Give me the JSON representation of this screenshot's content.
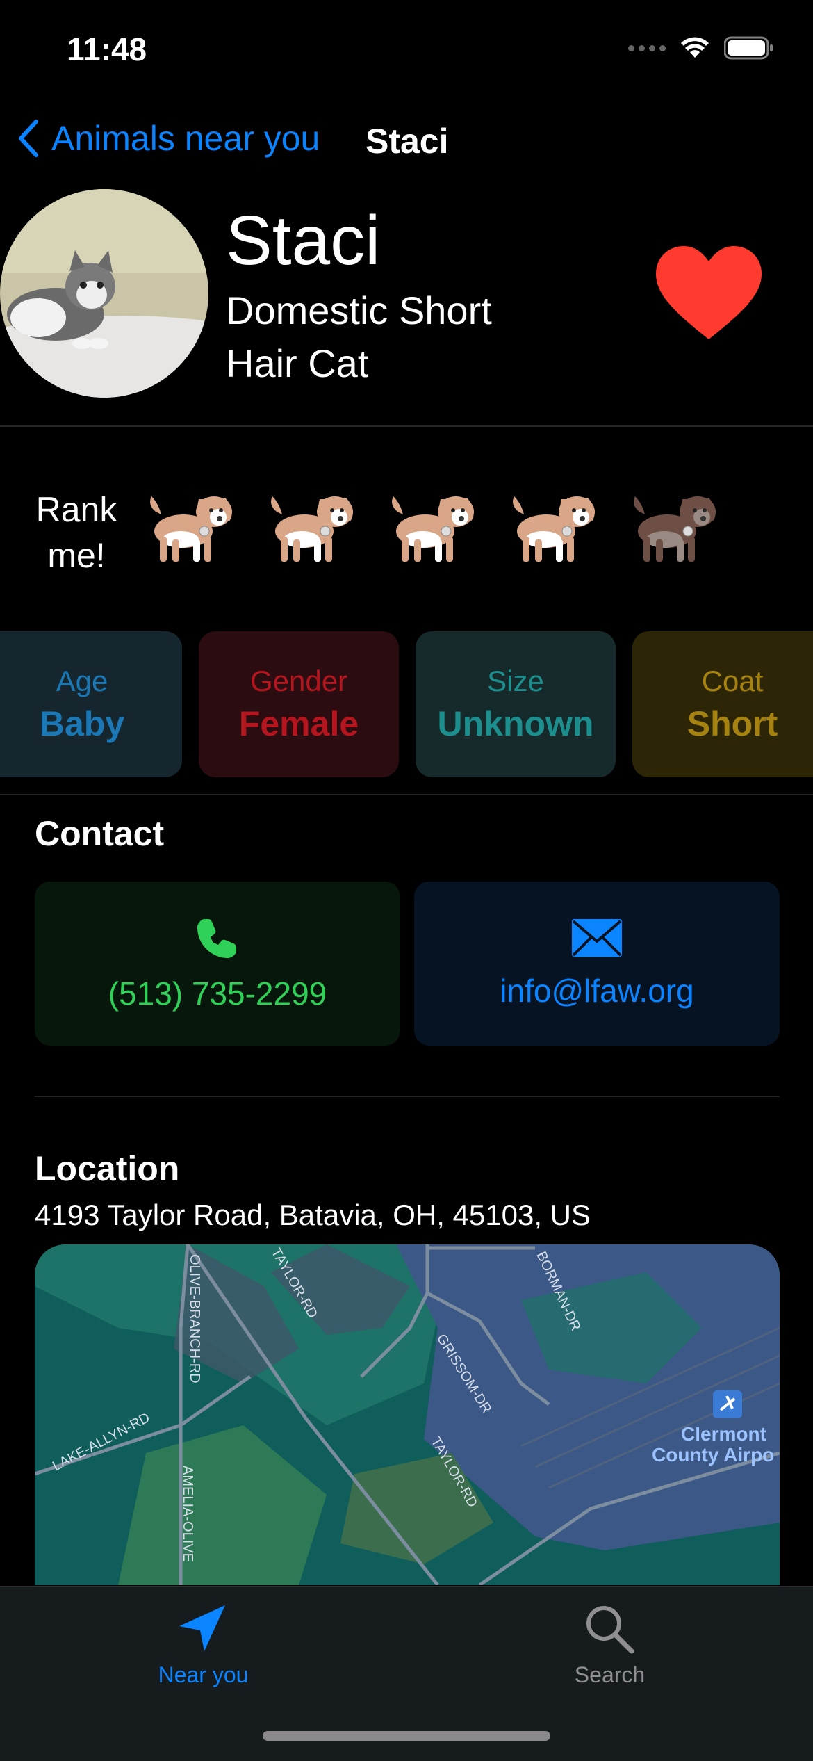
{
  "status_bar": {
    "time": "11:48"
  },
  "nav": {
    "back_label": "Animals near you",
    "title": "Staci"
  },
  "animal": {
    "name": "Staci",
    "breed_line1": "Domestic Short",
    "breed_line2": "Hair Cat",
    "favorite": true
  },
  "rank": {
    "label_line1": "Rank",
    "label_line2": "me!",
    "max": 5,
    "value": 4
  },
  "attributes": [
    {
      "label": "Age",
      "value": "Baby",
      "color": "#1b78b5",
      "bg": "#15262f"
    },
    {
      "label": "Gender",
      "value": "Female",
      "color": "#b3161e",
      "bg": "#2b0c10"
    },
    {
      "label": "Size",
      "value": "Unknown",
      "color": "#1c8e8e",
      "bg": "#172a2b"
    },
    {
      "label": "Coat",
      "value": "Short",
      "color": "#a68210",
      "bg": "#2d2606"
    }
  ],
  "contact": {
    "title": "Contact",
    "phone": "(513) 735-2299",
    "phone_color": "#30d158",
    "email": "info@lfaw.org",
    "email_color": "#0a84ff"
  },
  "location": {
    "title": "Location",
    "address": "4193 Taylor Road, Batavia, OH, 45103, US",
    "map_labels": [
      "OLIVE-BRANCH-RD",
      "TAYLOR-RD",
      "BORMAN-DR",
      "GRISSOM-DR",
      "LAKE-ALLYN-RD",
      "TAYLOR-RD",
      "AMELIA-OLIVE",
      "Clermont",
      "County Airpo"
    ]
  },
  "tabs": [
    {
      "label": "Near you",
      "icon": "location-arrow-icon",
      "active": true
    },
    {
      "label": "Search",
      "icon": "magnifier-icon",
      "active": false
    }
  ],
  "colors": {
    "accent": "#0a84ff",
    "heart": "#ff3b30",
    "inactive_tab": "#8e8e93"
  }
}
